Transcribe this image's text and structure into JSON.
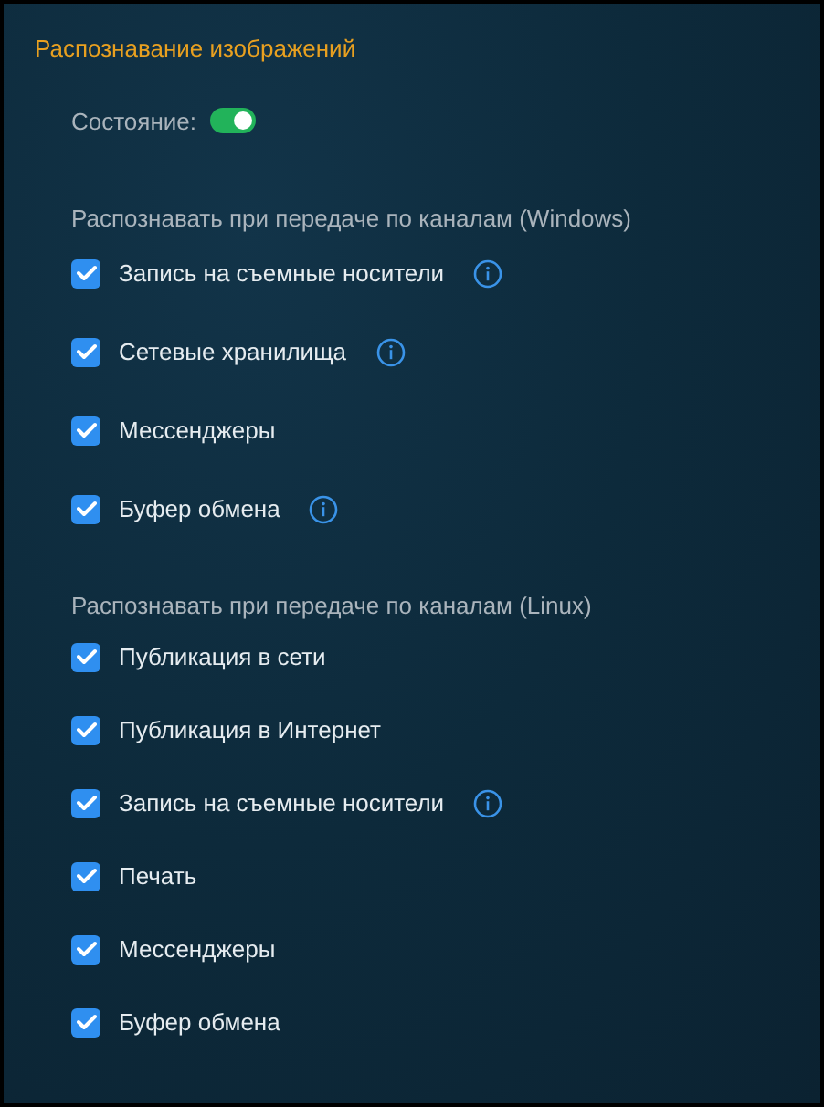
{
  "title": "Распознавание изображений",
  "state": {
    "label": "Состояние:",
    "on": true
  },
  "groups": [
    {
      "heading": "Распознавать при передаче по каналам (Windows)",
      "items": [
        {
          "label": "Запись на съемные носители",
          "checked": true,
          "info": true
        },
        {
          "label": "Сетевые хранилища",
          "checked": true,
          "info": true
        },
        {
          "label": "Мессенджеры",
          "checked": true,
          "info": false
        },
        {
          "label": "Буфер обмена",
          "checked": true,
          "info": true
        }
      ]
    },
    {
      "heading": "Распознавать при передаче по каналам (Linux)",
      "items": [
        {
          "label": "Публикация в сети",
          "checked": true,
          "info": false
        },
        {
          "label": "Публикация в Интернет",
          "checked": true,
          "info": false
        },
        {
          "label": "Запись на съемные носители",
          "checked": true,
          "info": true
        },
        {
          "label": "Печать",
          "checked": true,
          "info": false
        },
        {
          "label": "Мессенджеры",
          "checked": true,
          "info": false
        },
        {
          "label": "Буфер обмена",
          "checked": true,
          "info": false
        }
      ]
    }
  ]
}
